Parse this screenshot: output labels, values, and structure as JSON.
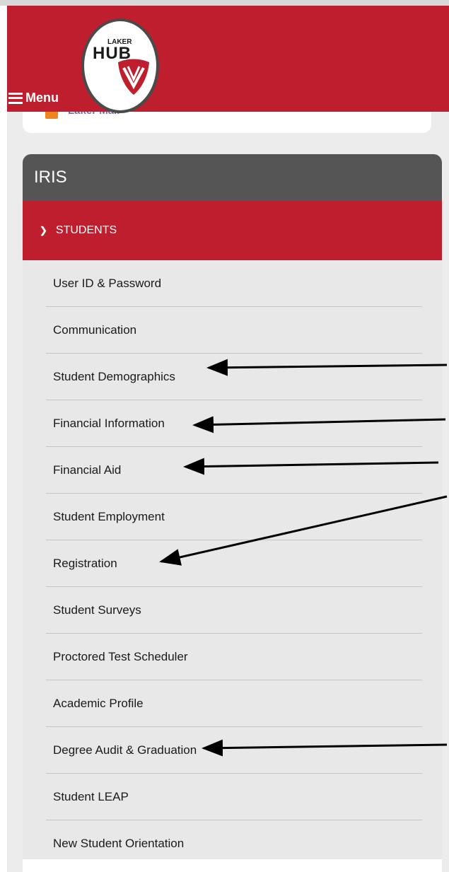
{
  "header": {
    "menu_label": "Menu",
    "logo_top": "LAKER",
    "logo_main": "HUB"
  },
  "previous_card": {
    "label": "Laker Mail",
    "icon": "mail-icon"
  },
  "card": {
    "title": "IRIS",
    "section": {
      "label": "STUDENTS",
      "icon": "chevron-down-icon"
    },
    "items": [
      {
        "label": "User ID & Password"
      },
      {
        "label": "Communication"
      },
      {
        "label": "Student Demographics"
      },
      {
        "label": "Financial Information"
      },
      {
        "label": "Financial Aid"
      },
      {
        "label": "Student Employment"
      },
      {
        "label": "Registration"
      },
      {
        "label": "Student Surveys"
      },
      {
        "label": "Proctored Test Scheduler"
      },
      {
        "label": "Academic Profile"
      },
      {
        "label": "Degree Audit & Graduation"
      },
      {
        "label": "Student LEAP"
      },
      {
        "label": "New Student Orientation"
      }
    ]
  },
  "colors": {
    "brand_red": "#be1e2d",
    "header_gray": "#555555",
    "panel_gray": "#e8e8e8"
  }
}
